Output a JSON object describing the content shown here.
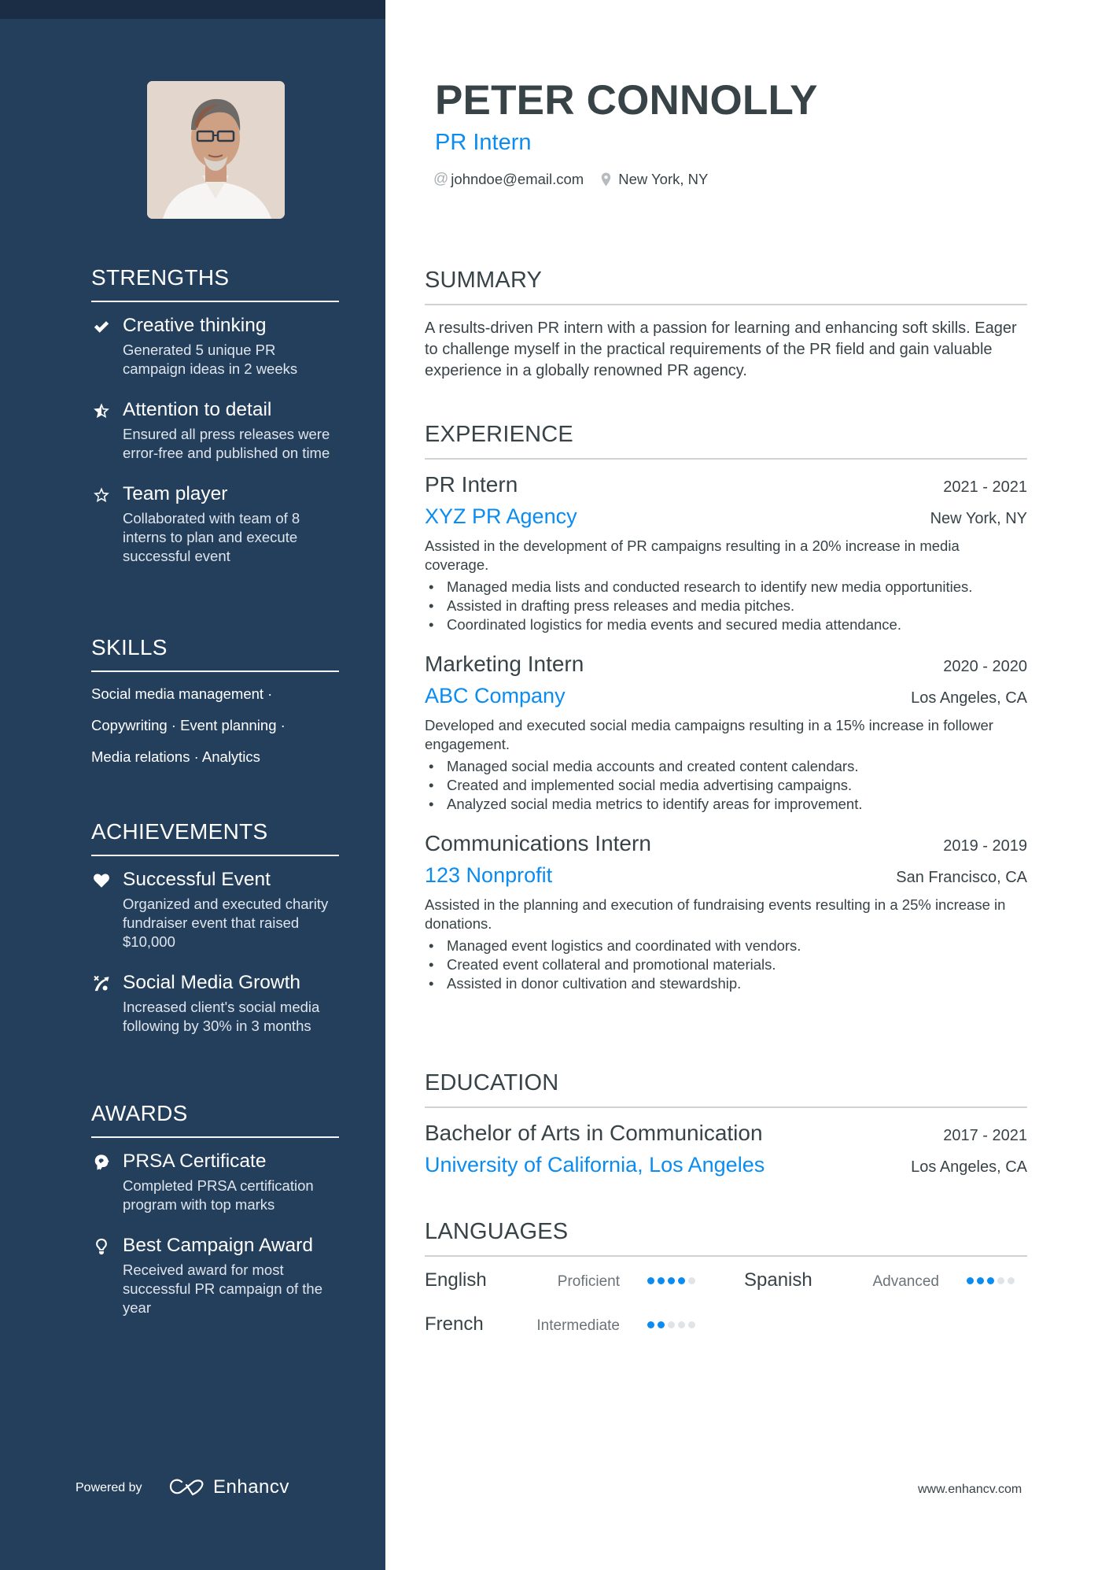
{
  "profile": {
    "name": "PETER CONNOLLY",
    "title": "PR Intern",
    "email": "johndoe@email.com",
    "location": "New York, NY",
    "email_icon": "at-icon",
    "location_icon": "map-pin-icon",
    "photo_alt": "Profile photo"
  },
  "sidebar": {
    "strengths": {
      "title": "STRENGTHS",
      "items": [
        {
          "icon": "check-icon",
          "title": "Creative thinking",
          "desc": "Generated 5 unique PR campaign ideas in 2 weeks"
        },
        {
          "icon": "half-star-icon",
          "title": "Attention to detail",
          "desc": "Ensured all press releases were error-free and published on time"
        },
        {
          "icon": "star-outline-icon",
          "title": "Team player",
          "desc": "Collaborated with team of 8 interns to plan and execute successful event"
        }
      ]
    },
    "skills": {
      "title": "SKILLS",
      "lines": [
        "Social media management ·",
        "Copywriting · Event planning ·",
        "Media relations · Analytics"
      ]
    },
    "achievements": {
      "title": "ACHIEVEMENTS",
      "items": [
        {
          "icon": "heart-icon",
          "title": "Successful Event",
          "desc": "Organized and executed charity fundraiser event that raised $10,000"
        },
        {
          "icon": "growth-strategy-icon",
          "title": "Social Media Growth",
          "desc": "Increased client's social media following by 30% in 3 months"
        }
      ]
    },
    "awards": {
      "title": "AWARDS",
      "items": [
        {
          "icon": "brain-head-icon",
          "title": "PRSA Certificate",
          "desc": "Completed PRSA certification program with top marks"
        },
        {
          "icon": "lightbulb-icon",
          "title": "Best Campaign Award",
          "desc": "Received award for most successful PR campaign of the year"
        }
      ]
    },
    "footer": {
      "powered_by": "Powered by",
      "brand": "Enhancv"
    }
  },
  "main": {
    "summary": {
      "title": "SUMMARY",
      "text": "A results-driven PR intern with a passion for learning and enhancing soft skills. Eager to challenge myself in the practical requirements of the PR field and gain valuable experience in a globally renowned PR agency."
    },
    "experience": {
      "title": "EXPERIENCE",
      "jobs": [
        {
          "title": "PR Intern",
          "dates": "2021 - 2021",
          "company": "XYZ PR Agency",
          "location": "New York, NY",
          "desc": "Assisted in the development of PR campaigns resulting in a 20% increase in media coverage.",
          "bullets": [
            "Managed media lists and conducted research to identify new media opportunities.",
            "Assisted in drafting press releases and media pitches.",
            "Coordinated logistics for media events and secured media attendance."
          ]
        },
        {
          "title": "Marketing Intern",
          "dates": "2020 - 2020",
          "company": "ABC Company",
          "location": "Los Angeles, CA",
          "desc": "Developed and executed social media campaigns resulting in a 15% increase in follower engagement.",
          "bullets": [
            "Managed social media accounts and created content calendars.",
            "Created and implemented social media advertising campaigns.",
            "Analyzed social media metrics to identify areas for improvement."
          ]
        },
        {
          "title": "Communications Intern",
          "dates": "2019 - 2019",
          "company": "123 Nonprofit",
          "location": "San Francisco, CA",
          "desc": "Assisted in the planning and execution of fundraising events resulting in a 25% increase in donations.",
          "bullets": [
            "Managed event logistics and coordinated with vendors.",
            "Created event collateral and promotional materials.",
            "Assisted in donor cultivation and stewardship."
          ]
        }
      ]
    },
    "education": {
      "title": "EDUCATION",
      "items": [
        {
          "degree": "Bachelor of Arts in Communication",
          "dates": "2017 - 2021",
          "school": "University of California, Los Angeles",
          "location": "Los Angeles, CA"
        }
      ]
    },
    "languages": {
      "title": "LANGUAGES",
      "items": [
        {
          "name": "English",
          "level": "Proficient",
          "rating": 4,
          "max": 5
        },
        {
          "name": "Spanish",
          "level": "Advanced",
          "rating": 3,
          "max": 5
        },
        {
          "name": "French",
          "level": "Intermediate",
          "rating": 2,
          "max": 5
        }
      ]
    }
  },
  "footer": {
    "website": "www.enhancv.com"
  },
  "colors": {
    "sidebar": "#243f5c",
    "topband": "#1b2d45",
    "accent": "#0a8cf0",
    "text": "#384347",
    "rule": "#cfd3d6",
    "dot_off": "#e1e4e6"
  }
}
